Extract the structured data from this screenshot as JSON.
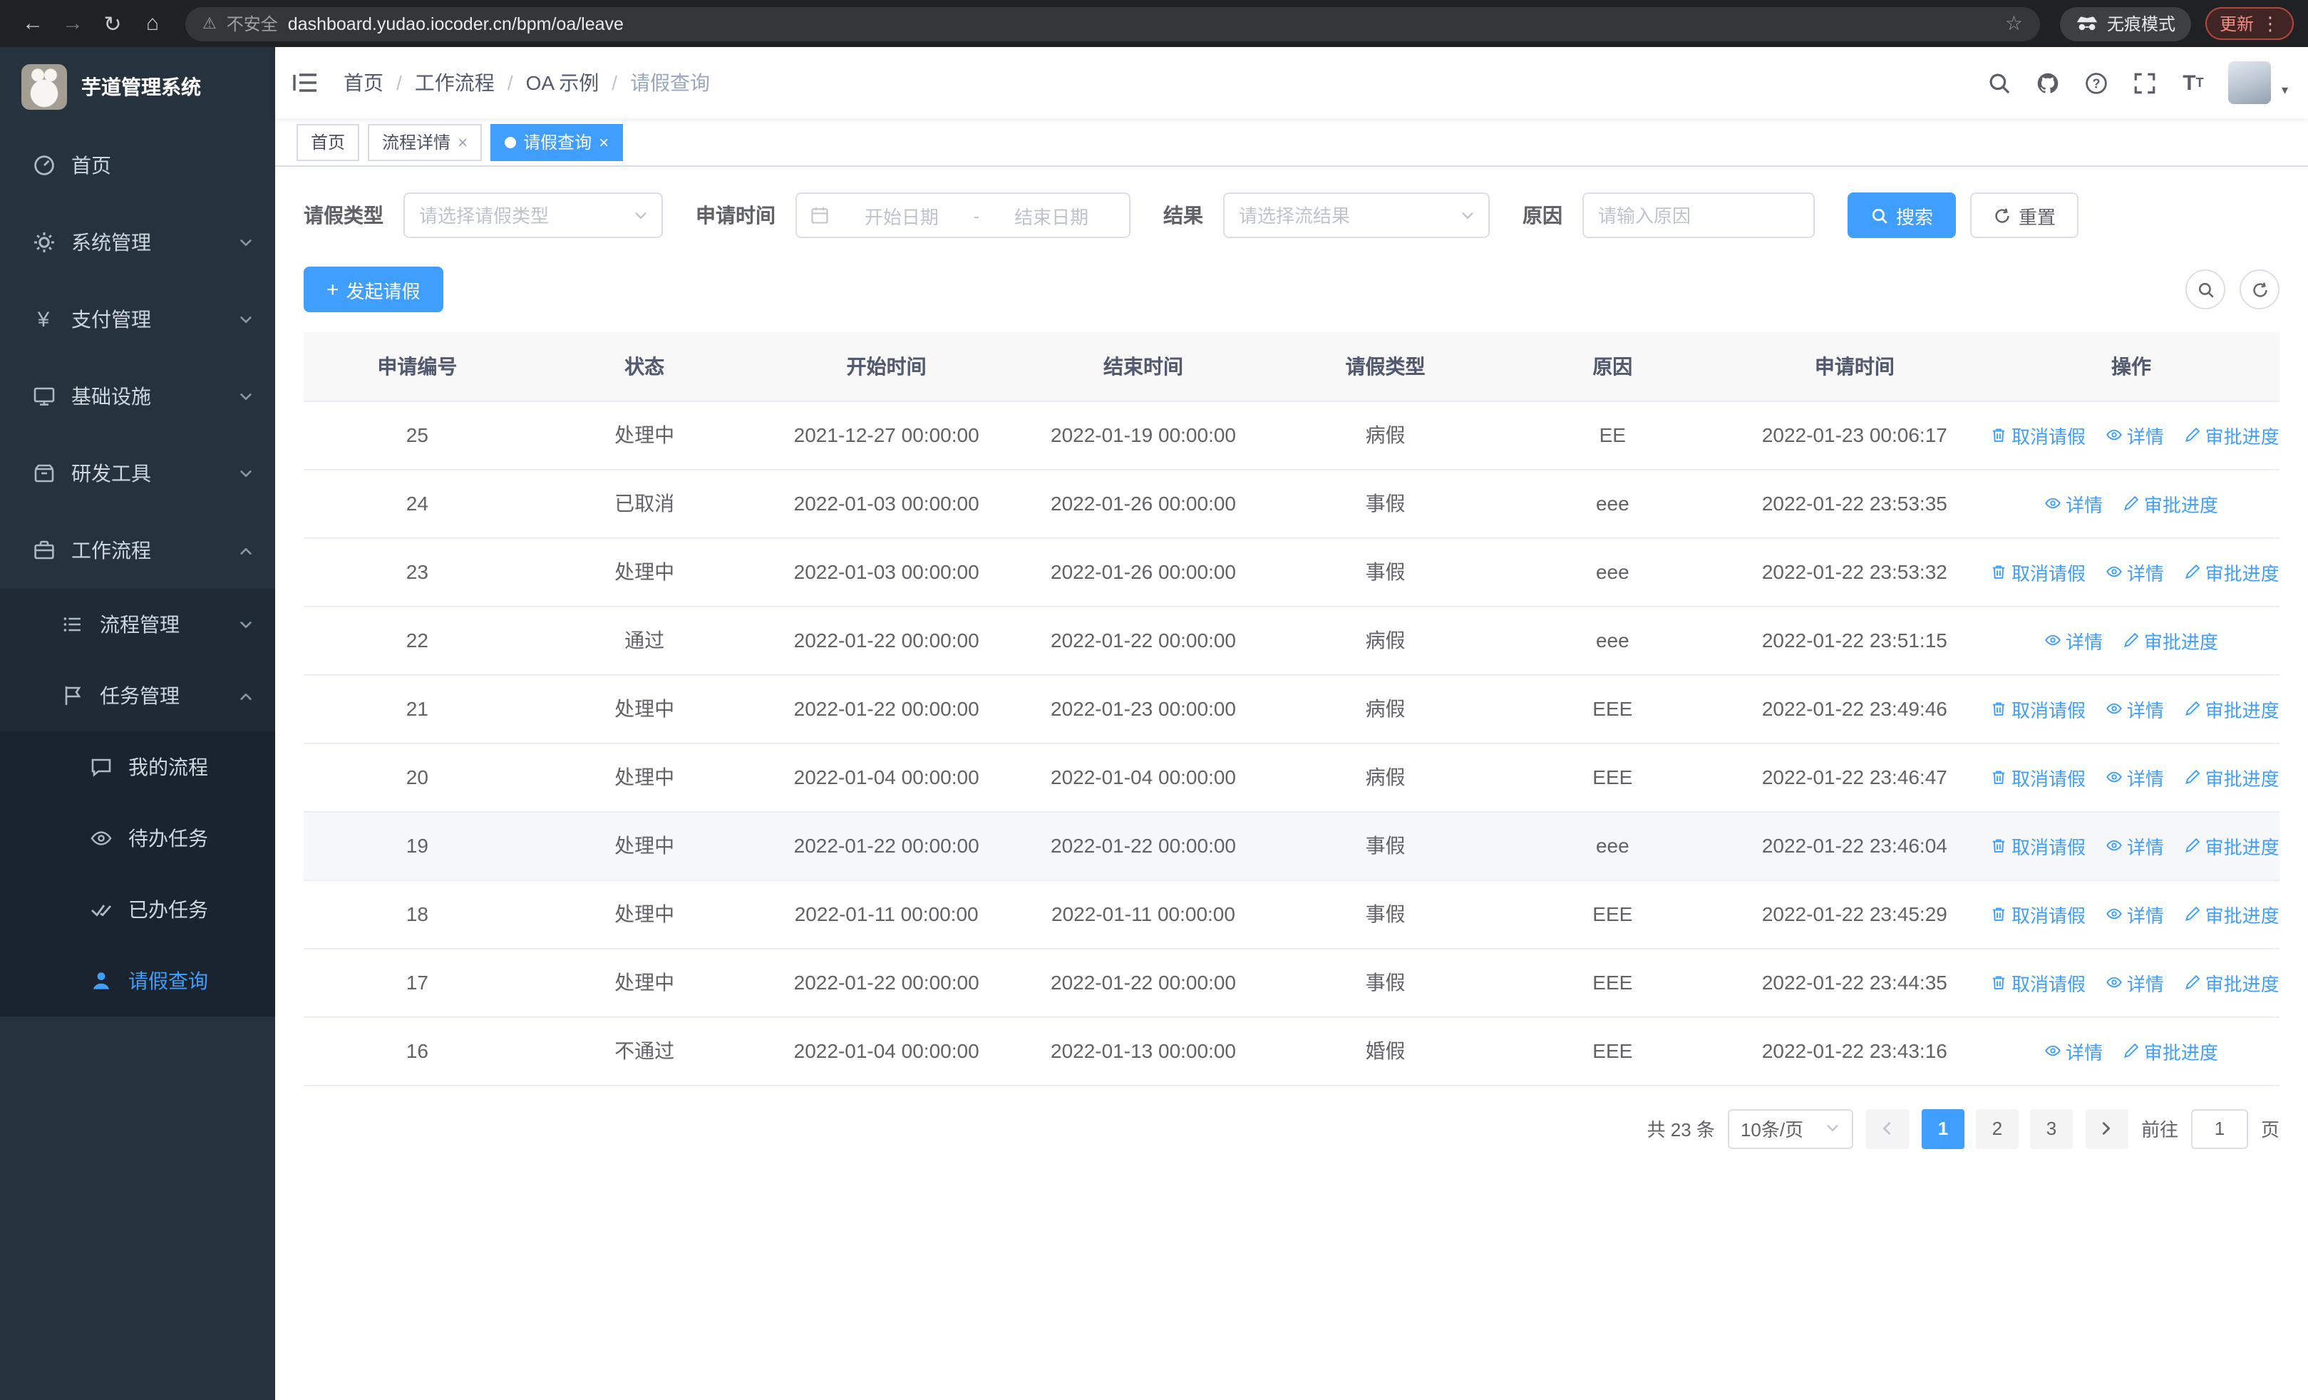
{
  "browser": {
    "security_label": "不安全",
    "url": "dashboard.yudao.iocoder.cn/bpm/oa/leave",
    "incognito_label": "无痕模式",
    "update_label": "更新"
  },
  "sidebar": {
    "title": "芋道管理系统",
    "home": "首页",
    "system": "系统管理",
    "payment": "支付管理",
    "infra": "基础设施",
    "devtools": "研发工具",
    "workflow": "工作流程",
    "process_mgmt": "流程管理",
    "task_mgmt": "任务管理",
    "my_process": "我的流程",
    "todo_tasks": "待办任务",
    "done_tasks": "已办任务",
    "leave_query": "请假查询"
  },
  "breadcrumb": {
    "home": "首页",
    "workflow": "工作流程",
    "oa": "OA 示例",
    "current": "请假查询"
  },
  "tabs": [
    {
      "label": "首页"
    },
    {
      "label": "流程详情"
    },
    {
      "label": "请假查询"
    }
  ],
  "filters": {
    "leave_type_label": "请假类型",
    "leave_type_placeholder": "请选择请假类型",
    "apply_time_label": "申请时间",
    "date_start_placeholder": "开始日期",
    "date_separator": "-",
    "date_end_placeholder": "结束日期",
    "result_label": "结果",
    "result_placeholder": "请选择流结果",
    "reason_label": "原因",
    "reason_placeholder": "请输入原因",
    "search_button": "搜索",
    "reset_button": "重置"
  },
  "toolbar": {
    "create_button": "发起请假"
  },
  "table": {
    "columns": [
      "申请编号",
      "状态",
      "开始时间",
      "结束时间",
      "请假类型",
      "原因",
      "申请时间",
      "操作"
    ],
    "action_labels": {
      "cancel": "取消请假",
      "detail": "详情",
      "progress": "审批进度"
    },
    "rows": [
      {
        "id": "25",
        "status": "处理中",
        "start": "2021-12-27 00:00:00",
        "end": "2022-01-19 00:00:00",
        "type": "病假",
        "reason": "EE",
        "apply_time": "2022-01-23 00:06:17",
        "has_cancel": true
      },
      {
        "id": "24",
        "status": "已取消",
        "start": "2022-01-03 00:00:00",
        "end": "2022-01-26 00:00:00",
        "type": "事假",
        "reason": "eee",
        "apply_time": "2022-01-22 23:53:35",
        "has_cancel": false
      },
      {
        "id": "23",
        "status": "处理中",
        "start": "2022-01-03 00:00:00",
        "end": "2022-01-26 00:00:00",
        "type": "事假",
        "reason": "eee",
        "apply_time": "2022-01-22 23:53:32",
        "has_cancel": true
      },
      {
        "id": "22",
        "status": "通过",
        "start": "2022-01-22 00:00:00",
        "end": "2022-01-22 00:00:00",
        "type": "病假",
        "reason": "eee",
        "apply_time": "2022-01-22 23:51:15",
        "has_cancel": false
      },
      {
        "id": "21",
        "status": "处理中",
        "start": "2022-01-22 00:00:00",
        "end": "2022-01-23 00:00:00",
        "type": "病假",
        "reason": "EEE",
        "apply_time": "2022-01-22 23:49:46",
        "has_cancel": true
      },
      {
        "id": "20",
        "status": "处理中",
        "start": "2022-01-04 00:00:00",
        "end": "2022-01-04 00:00:00",
        "type": "病假",
        "reason": "EEE",
        "apply_time": "2022-01-22 23:46:47",
        "has_cancel": true
      },
      {
        "id": "19",
        "status": "处理中",
        "start": "2022-01-22 00:00:00",
        "end": "2022-01-22 00:00:00",
        "type": "事假",
        "reason": "eee",
        "apply_time": "2022-01-22 23:46:04",
        "has_cancel": true,
        "row_class": "hl"
      },
      {
        "id": "18",
        "status": "处理中",
        "start": "2022-01-11 00:00:00",
        "end": "2022-01-11 00:00:00",
        "type": "事假",
        "reason": "EEE",
        "apply_time": "2022-01-22 23:45:29",
        "has_cancel": true
      },
      {
        "id": "17",
        "status": "处理中",
        "start": "2022-01-22 00:00:00",
        "end": "2022-01-22 00:00:00",
        "type": "事假",
        "reason": "EEE",
        "apply_time": "2022-01-22 23:44:35",
        "has_cancel": true
      },
      {
        "id": "16",
        "status": "不通过",
        "start": "2022-01-04 00:00:00",
        "end": "2022-01-13 00:00:00",
        "type": "婚假",
        "reason": "EEE",
        "apply_time": "2022-01-22 23:43:16",
        "has_cancel": false
      }
    ]
  },
  "pagination": {
    "total_label": "共 23 条",
    "page_size": "10条/页",
    "pages": [
      "1",
      "2",
      "3"
    ],
    "goto_label": "前往",
    "goto_value": "1",
    "page_unit": "页"
  }
}
